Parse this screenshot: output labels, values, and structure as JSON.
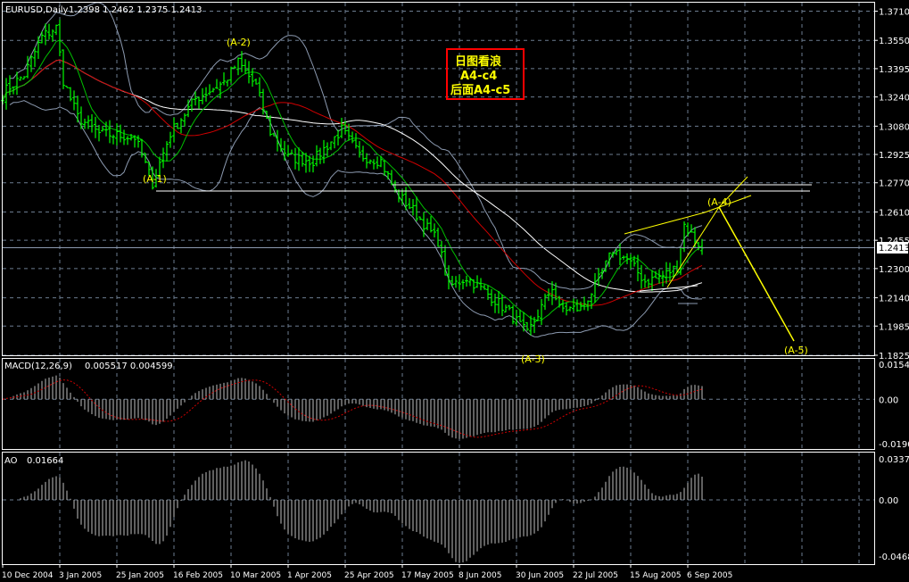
{
  "header": {
    "symbol": "EURUSD,Daily",
    "ohlc": "1.2398 1.2462 1.2375 1.2413"
  },
  "current_price_label": "1.2413",
  "note_box": {
    "line1": "日图看浪",
    "line2": "A4-c4",
    "line3": "后面A4-c5",
    "border_color": "#ff0000",
    "text_color": "#ffff00"
  },
  "wave_labels": [
    "(A-1)",
    "(A-2)",
    "(A-3)",
    "(A-4)",
    "(A-5)"
  ],
  "colors": {
    "background": "#000000",
    "bars": "#00ff00",
    "ma_fast": "#00c000",
    "ma_mid": "#d00000",
    "ma_slow": "#ffffff",
    "bollinger": "#8c9ab0",
    "grid": "#6c7c90",
    "wave_lines": "#ffff00",
    "macd_signal": "#d00000",
    "histogram": "#c0c0c0"
  },
  "chart_data": [
    {
      "type": "ohlc",
      "title": "EURUSD,Daily",
      "price_ticks": [
        "1.3710",
        "1.3550",
        "1.3395",
        "1.3240",
        "1.3080",
        "1.2925",
        "1.2770",
        "1.2610",
        "1.2455",
        "1.2300",
        "1.2140",
        "1.1985",
        "1.1825"
      ],
      "ylim": [
        1.1825,
        1.371
      ],
      "grid": true,
      "x_tick_labels": [
        "10 Dec 2004",
        "3 Jan 2005",
        "25 Jan 2005",
        "16 Feb 2005",
        "10 Mar 2005",
        "1 Apr 2005",
        "25 Apr 2005",
        "17 May 2005",
        "8 Jun 2005",
        "30 Jun 2005",
        "22 Jul 2005",
        "15 Aug 2005",
        "6 Sep 2005"
      ],
      "last_bar": {
        "open": 1.2398,
        "high": 1.2462,
        "low": 1.2375,
        "close": 1.2413
      },
      "close_anchors": [
        [
          "2004-12-10",
          1.325
        ],
        [
          "2004-12-13",
          1.328
        ],
        [
          "2004-12-20",
          1.336
        ],
        [
          "2004-12-27",
          1.357
        ],
        [
          "2004-12-31",
          1.362
        ],
        [
          "2005-01-04",
          1.333
        ],
        [
          "2005-01-10",
          1.313
        ],
        [
          "2005-01-18",
          1.304
        ],
        [
          "2005-02-01",
          1.302
        ],
        [
          "2005-02-08",
          1.277
        ],
        [
          "2005-02-15",
          1.304
        ],
        [
          "2005-02-24",
          1.323
        ],
        [
          "2005-03-08",
          1.332
        ],
        [
          "2005-03-14",
          1.343
        ],
        [
          "2005-03-21",
          1.33
        ],
        [
          "2005-03-25",
          1.305
        ],
        [
          "2005-04-01",
          1.291
        ],
        [
          "2005-04-12",
          1.289
        ],
        [
          "2005-04-22",
          1.306
        ],
        [
          "2005-04-29",
          1.292
        ],
        [
          "2005-05-09",
          1.289
        ],
        [
          "2005-05-13",
          1.272
        ],
        [
          "2005-05-20",
          1.262
        ],
        [
          "2005-05-31",
          1.245
        ],
        [
          "2005-06-03",
          1.22
        ],
        [
          "2005-06-10",
          1.225
        ],
        [
          "2005-06-20",
          1.216
        ],
        [
          "2005-06-28",
          1.206
        ],
        [
          "2005-07-05",
          1.194
        ],
        [
          "2005-07-14",
          1.22
        ],
        [
          "2005-07-18",
          1.208
        ],
        [
          "2005-07-26",
          1.208
        ],
        [
          "2005-08-01",
          1.22
        ],
        [
          "2005-08-08",
          1.24
        ],
        [
          "2005-08-12",
          1.235
        ],
        [
          "2005-08-19",
          1.223
        ],
        [
          "2005-08-26",
          1.226
        ],
        [
          "2005-09-01",
          1.231
        ],
        [
          "2005-09-05",
          1.254
        ],
        [
          "2005-09-08",
          1.246
        ],
        [
          "2005-09-12",
          1.2413
        ]
      ],
      "horizontal_levels": [
        1.2759,
        1.2725
      ]
    },
    {
      "type": "bar",
      "title": "MACD(12,26,9)",
      "values_label": "0.005517  0.004599",
      "ticks": [
        "0.01548",
        "0.00",
        "-0.01902"
      ],
      "ylim": [
        -0.01902,
        0.01548
      ]
    },
    {
      "type": "bar",
      "title": "AO",
      "values_label": "0.01664",
      "ticks": [
        "0.0337",
        "0.00",
        "-0.0468"
      ],
      "ylim": [
        -0.0468,
        0.0337
      ]
    }
  ]
}
